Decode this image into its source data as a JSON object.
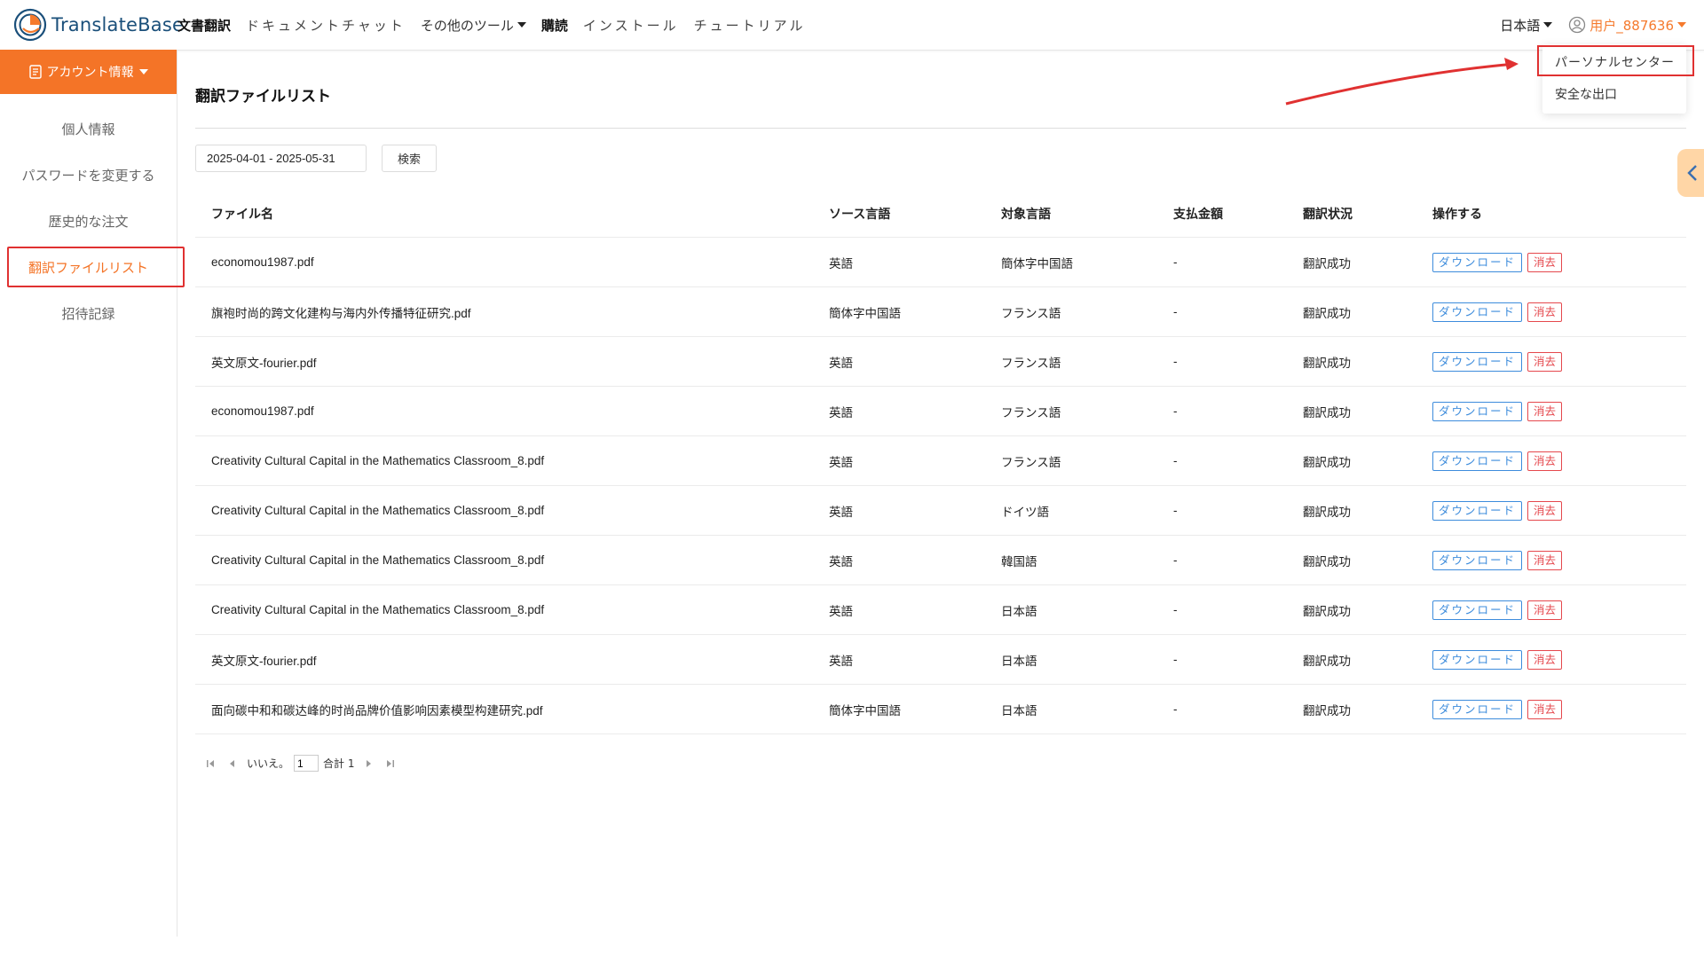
{
  "brand": {
    "name": "TranslateBase"
  },
  "nav": {
    "items": [
      {
        "label": "文書翻訳",
        "bold": true,
        "dropdown": false
      },
      {
        "label": "ドキュメントチャット",
        "bold": false,
        "dropdown": false
      },
      {
        "label": "その他のツール",
        "bold": false,
        "dropdown": true
      },
      {
        "label": "購読",
        "bold": true,
        "dropdown": false
      },
      {
        "label": "インストール",
        "bold": false,
        "dropdown": false
      },
      {
        "label": "チュートリアル",
        "bold": false,
        "dropdown": false
      }
    ],
    "language": "日本語",
    "user": "用户_887636"
  },
  "sidebar": {
    "header": "アカウント情報",
    "items": [
      {
        "label": "個人情報"
      },
      {
        "label": "パスワードを変更する"
      },
      {
        "label": "歴史的な注文"
      },
      {
        "label": "翻訳ファイルリスト",
        "active": true
      },
      {
        "label": "招待記録"
      }
    ]
  },
  "main": {
    "title": "翻訳ファイルリスト",
    "date_range": "2025-04-01 - 2025-05-31",
    "search_label": "検索",
    "columns": [
      "ファイル名",
      "ソース言語",
      "対象言語",
      "支払金額",
      "翻訳状況",
      "操作する"
    ],
    "download_label": "ダウンロード",
    "delete_label": "消去",
    "rows": [
      {
        "name": "economou1987.pdf",
        "src": "英語",
        "tgt": "簡体字中国語",
        "pay": "-",
        "status": "翻訳成功"
      },
      {
        "name": "旗袍时尚的跨文化建构与海内外传播特征研究.pdf",
        "src": "簡体字中国語",
        "tgt": "フランス語",
        "pay": "-",
        "status": "翻訳成功"
      },
      {
        "name": "英文原文-fourier.pdf",
        "src": "英語",
        "tgt": "フランス語",
        "pay": "-",
        "status": "翻訳成功"
      },
      {
        "name": "economou1987.pdf",
        "src": "英語",
        "tgt": "フランス語",
        "pay": "-",
        "status": "翻訳成功"
      },
      {
        "name": "Creativity Cultural Capital in the Mathematics Classroom_8.pdf",
        "src": "英語",
        "tgt": "フランス語",
        "pay": "-",
        "status": "翻訳成功"
      },
      {
        "name": "Creativity Cultural Capital in the Mathematics Classroom_8.pdf",
        "src": "英語",
        "tgt": "ドイツ語",
        "pay": "-",
        "status": "翻訳成功"
      },
      {
        "name": "Creativity Cultural Capital in the Mathematics Classroom_8.pdf",
        "src": "英語",
        "tgt": "韓国語",
        "pay": "-",
        "status": "翻訳成功"
      },
      {
        "name": "Creativity Cultural Capital in the Mathematics Classroom_8.pdf",
        "src": "英語",
        "tgt": "日本語",
        "pay": "-",
        "status": "翻訳成功"
      },
      {
        "name": "英文原文-fourier.pdf",
        "src": "英語",
        "tgt": "日本語",
        "pay": "-",
        "status": "翻訳成功"
      },
      {
        "name": "面向碳中和和碳达峰的时尚品牌价值影响因素模型构建研究.pdf",
        "src": "簡体字中国語",
        "tgt": "日本語",
        "pay": "-",
        "status": "翻訳成功"
      }
    ]
  },
  "pagination": {
    "page_prefix": "いいえ。",
    "page_value": "1",
    "total_label": "合計 1"
  },
  "dropdown": {
    "items": [
      "パーソナルセンター",
      "安全な出口"
    ]
  },
  "colors": {
    "accent": "#f47427",
    "highlight": "#e03131",
    "link": "#3d8cdc",
    "danger": "#e5484d"
  },
  "icons": [
    "logo-icon",
    "user-icon",
    "document-icon",
    "first-page-icon",
    "prev-page-icon",
    "next-page-icon",
    "last-page-icon",
    "chevron-left-icon"
  ]
}
